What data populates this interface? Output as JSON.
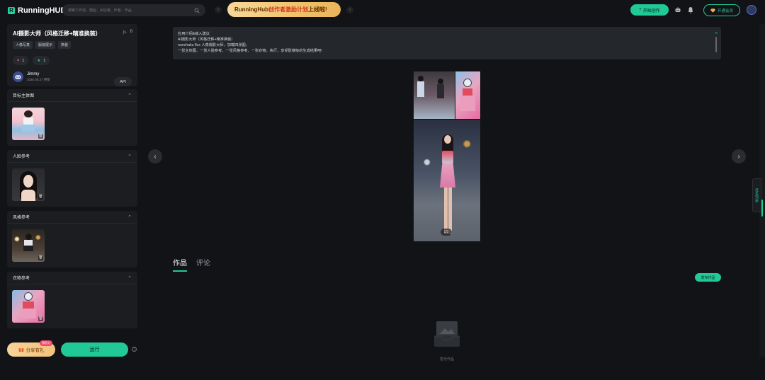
{
  "brand": {
    "name": "RunningHUB"
  },
  "search": {
    "placeholder": "搜索工作流、模型、AI应用、作者、作品"
  },
  "banner": {
    "prefix": "RunningHub",
    "highlight": "创作者激励计划",
    "suffix": "上线啦!"
  },
  "header": {
    "start_label": "开始创作",
    "vip_label": "开通会员"
  },
  "app": {
    "title": "AI摄影大师（风格迁移+精准换装）",
    "runs": "0",
    "tags": [
      "人像写真",
      "服装展示",
      "换装"
    ],
    "likes": "1",
    "favorites": "1",
    "api_label": "API",
    "author": "Jimmy",
    "updated": "2025.05.27 更新"
  },
  "sections": [
    {
      "title": "目标主体图"
    },
    {
      "title": "人脸参考"
    },
    {
      "title": "风格参考"
    },
    {
      "title": "衣物参考"
    }
  ],
  "actions": {
    "share_label": "分享有礼",
    "share_badge": "得积分",
    "run_label": "运行"
  },
  "intro": {
    "heading": "应用介绍&输入建议",
    "lines": [
      "AI摄影大师（风格迁移+精准换装）",
      "nunchaku flux 人像摄影大师，加载四张图，",
      "一张主体图、一张人脸参考、一张风格参考、一张衣物。执行，享受影楼级的生成结果吧!"
    ]
  },
  "gallery": {
    "counter": "1/2"
  },
  "tabs": [
    {
      "label": "作品",
      "active": true
    },
    {
      "label": "评论",
      "active": false
    }
  ],
  "works": {
    "publish_label": "发布作品",
    "empty_label": "暂无作品"
  },
  "side": {
    "tab_label": "任务列表"
  },
  "colors": {
    "accent": "#21c996",
    "background": "#121316",
    "card": "#1b1d21"
  }
}
